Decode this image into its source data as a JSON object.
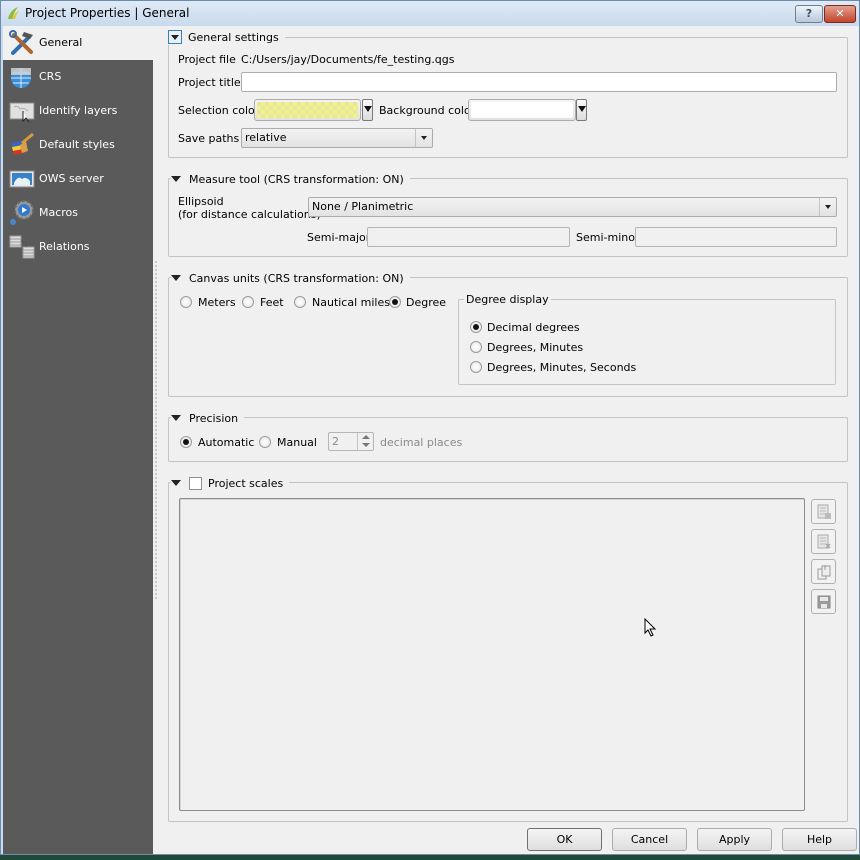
{
  "window": {
    "title": "Project Properties | General",
    "help_button": "?",
    "close_button": "✕"
  },
  "sidebar": {
    "items": [
      {
        "label": "General",
        "icon": "hammer-wrench-icon",
        "active": true
      },
      {
        "label": "CRS",
        "icon": "globe-grid-icon",
        "active": false
      },
      {
        "label": "Identify layers",
        "icon": "map-pointer-icon",
        "active": false
      },
      {
        "label": "Default styles",
        "icon": "paintbrush-icon",
        "active": false
      },
      {
        "label": "OWS server",
        "icon": "map-server-icon",
        "active": false
      },
      {
        "label": "Macros",
        "icon": "gear-play-icon",
        "active": false
      },
      {
        "label": "Relations",
        "icon": "table-relation-icon",
        "active": false
      }
    ]
  },
  "general_settings": {
    "title": "General settings",
    "project_file_label": "Project file",
    "project_file_value": "C:/Users/jay/Documents/fe_testing.qgs",
    "project_title_label": "Project title",
    "project_title_value": "",
    "selection_color_label": "Selection color",
    "selection_color": "#f2f28a",
    "background_color_label": "Background color",
    "background_color": "#ffffff",
    "save_paths_label": "Save paths",
    "save_paths_value": "relative"
  },
  "measure_tool": {
    "title": "Measure tool (CRS transformation: ON)",
    "ellipsoid_label_line1": "Ellipsoid",
    "ellipsoid_label_line2": "(for distance calculations)",
    "ellipsoid_value": "None / Planimetric",
    "semi_major_label": "Semi-major",
    "semi_major_value": "",
    "semi_minor_label": "Semi-minor",
    "semi_minor_value": ""
  },
  "canvas_units": {
    "title": "Canvas units (CRS transformation: ON)",
    "options": [
      {
        "label": "Meters",
        "selected": false
      },
      {
        "label": "Feet",
        "selected": false
      },
      {
        "label": "Nautical miles",
        "selected": false
      },
      {
        "label": "Degree",
        "selected": true
      }
    ],
    "degree_display": {
      "title": "Degree display",
      "options": [
        {
          "label": "Decimal degrees",
          "selected": true
        },
        {
          "label": "Degrees, Minutes",
          "selected": false
        },
        {
          "label": "Degrees, Minutes, Seconds",
          "selected": false
        }
      ]
    }
  },
  "precision": {
    "title": "Precision",
    "automatic_label": "Automatic",
    "automatic_selected": true,
    "manual_label": "Manual",
    "manual_selected": false,
    "decimal_value": "2",
    "decimal_suffix": "decimal places"
  },
  "project_scales": {
    "title": "Project scales",
    "checked": false,
    "items": [],
    "tools": [
      "add-scale-icon",
      "remove-scale-icon",
      "import-scales-icon",
      "save-scales-icon"
    ]
  },
  "buttons": {
    "ok": "OK",
    "cancel": "Cancel",
    "apply": "Apply",
    "help": "Help"
  }
}
